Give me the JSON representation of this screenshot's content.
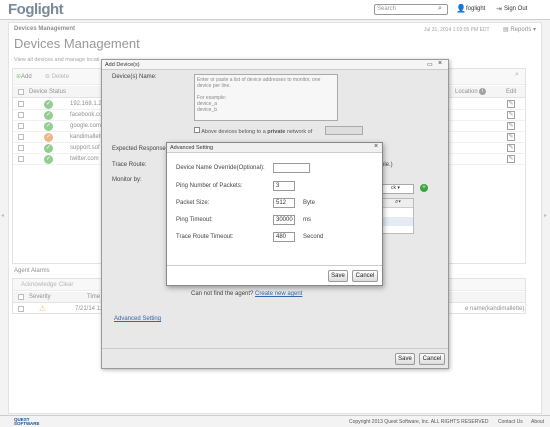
{
  "header": {
    "logo": "Foglight",
    "search_placeholder": "Search",
    "user": "foglight",
    "sign_out": "Sign Out"
  },
  "breadcrumb": "Devices Management",
  "page_title": "Devices Management",
  "timestamp": "Jul 31, 2014 1:03:05 PM EDT",
  "reports_label": "Reports",
  "subtitle": "View all devices and manage locati",
  "toolbar": {
    "add": "Add",
    "delete": "Delete"
  },
  "table": {
    "col_device_status": "Device Status",
    "col_location": "Location",
    "col_edit": "Edit",
    "rows": [
      {
        "name": "192.168.1.2",
        "status": "green"
      },
      {
        "name": "facebook.co",
        "status": "green"
      },
      {
        "name": "google.com",
        "status": "green"
      },
      {
        "name": "kandimallett",
        "status": "orange"
      },
      {
        "name": "support.sof",
        "status": "green"
      },
      {
        "name": "twitter.com",
        "status": "green"
      }
    ]
  },
  "agent_alarms": {
    "title": "Agent Alarms",
    "acknowledge": "Acknowledge",
    "clear": "Clear",
    "col_severity": "Severity",
    "col_time": "Time",
    "row_time": "7/21/14 12:0",
    "row_right": "e name(kandimallette)"
  },
  "add_device": {
    "title": "Add Device(s)",
    "device_names_label": "Device(s) Name:",
    "device_names_placeholder": "Enter or paste a list of device addresses to monitor, one device per line.\n\nFor example:\ndevice_a\ndevice_b",
    "above_devices_text": "Above devices belong to a ",
    "private_word": "private",
    "network_text": " network of",
    "expected_response": "Expected Response",
    "trace_route": "Trace Route:",
    "monitor_by": "Monitor by:",
    "agent_not_found": "Can not find the agent?",
    "create_agent": "Create new agent",
    "advanced_link": "Advanced Setting",
    "ple": "ple.)",
    "save": "Save",
    "cancel": "Cancel"
  },
  "advanced": {
    "title": "Advanced Setting",
    "fields": [
      {
        "label": "Device Name Override(Optional):",
        "value": "",
        "unit": ""
      },
      {
        "label": "Ping Number of Packets:",
        "value": "3",
        "unit": ""
      },
      {
        "label": "Packet Size:",
        "value": "512",
        "unit": "Byte"
      },
      {
        "label": "Ping Timeout:",
        "value": "30000",
        "unit": "ms"
      },
      {
        "label": "Trace Route Timeout:",
        "value": "480",
        "unit": "Second"
      }
    ],
    "save": "Save",
    "cancel": "Cancel"
  },
  "footer": {
    "brand": "QUEST SOFTWARE",
    "copyright": "Copyright 2013 Quest Software, Inc. ALL RIGHTS RESERVED",
    "contact": "Contact Us",
    "about": "About"
  }
}
